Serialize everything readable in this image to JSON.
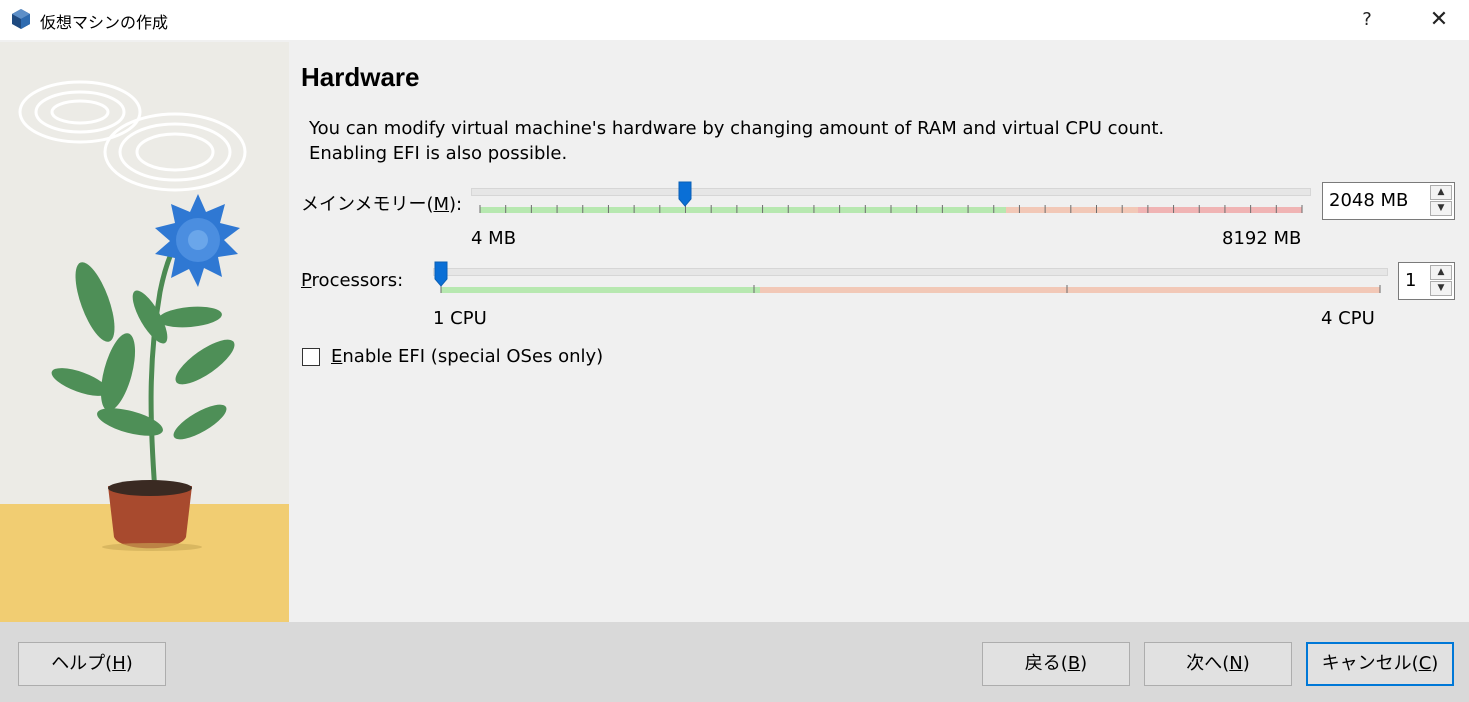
{
  "window": {
    "title": "仮想マシンの作成",
    "help_glyph": "?",
    "close_glyph": "✕",
    "app_icon": "virtualbox-cube-icon"
  },
  "page": {
    "heading": "Hardware",
    "description": "You can modify virtual machine's hardware by changing amount of RAM and virtual CPU count.\nEnabling EFI is also possible."
  },
  "memory": {
    "label_pre": "メインメモリー(",
    "label_mnemonic": "M",
    "label_post": "):",
    "min_label": "4 MB",
    "max_label": "8192 MB",
    "min": 4,
    "max": 8192,
    "value": 2048,
    "spin_text": "2048 MB",
    "safe_fraction": 0.64,
    "warn_fraction": 0.8
  },
  "processors": {
    "label_mnemonic": "P",
    "label_post": "rocessors:",
    "min_label": "1 CPU",
    "max_label": "4 CPU",
    "min": 1,
    "max": 4,
    "value": 1,
    "spin_text": "1",
    "safe_fraction": 0.34
  },
  "efi": {
    "mnemonic": "E",
    "label_post": "nable EFI (special OSes only)",
    "checked": false
  },
  "buttons": {
    "help": {
      "pre": "ヘルプ(",
      "mnemonic": "H",
      "post": ")"
    },
    "back": {
      "pre": "戻る(",
      "mnemonic": "B",
      "post": ")"
    },
    "next": {
      "pre": "次へ(",
      "mnemonic": "N",
      "post": ")"
    },
    "cancel": {
      "pre": "キャンセル(",
      "mnemonic": "C",
      "post": ")"
    }
  },
  "colors": {
    "safe_zone": "#b7e8b0",
    "caution_zone": "#f2c8b7",
    "danger_zone": "#f0b4b4",
    "thumb": "#0a6fd6",
    "default_button_border": "#0078d7",
    "floor": "#f1cd72",
    "flower": "#2f78d3"
  }
}
